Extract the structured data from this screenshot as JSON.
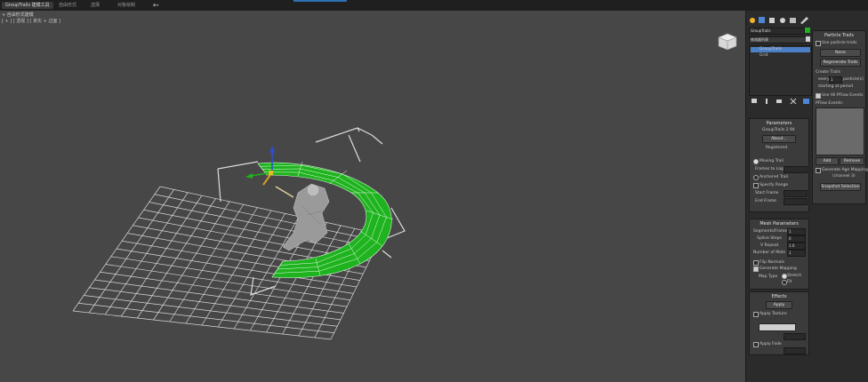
{
  "topbar": {
    "tabs": [
      {
        "label": "GroupTrails 建模工具",
        "active": true
      },
      {
        "label": "自由形式",
        "active": false
      },
      {
        "label": "选择",
        "active": false
      },
      {
        "label": "对象绘制",
        "active": false
      }
    ]
  },
  "viewport": {
    "label": "+ 自由形式建模",
    "menu": "[ + ] [ 透视 ] [ 真实 + 边面 ]"
  },
  "modifier_stack": {
    "name_field": "GroupTrails",
    "modifier_list": "修改器列表",
    "items": [
      {
        "label": "GroupTrails",
        "selected": true
      },
      {
        "label": "Grid",
        "selected": false
      }
    ]
  },
  "parameters": {
    "title": "Parameters",
    "version": "GroupTrails 2.94",
    "about_button": "About...",
    "status": "Registered",
    "moving_trail": "Moving Trail",
    "frames_to_lag": "Frames to Lag",
    "anchored_trail": "Anchored Trail",
    "specify_range": "Specify Range",
    "start_frame": "Start Frame",
    "end_frame": "End Frame"
  },
  "mesh_parameters": {
    "title": "Mesh Parameters",
    "segments_per_frame": "Segments/Frame",
    "segments_per_frame_value": "1",
    "spline_steps": "Spline Steps",
    "spline_steps_value": "0",
    "v_repeat": "V Repeat",
    "v_repeat_value": "1.0",
    "number_of_mats": "Number of Mats",
    "number_of_mats_value": "1",
    "flip_normals": "Flip Normals",
    "generate_mapping": "Generate Mapping",
    "map_type": "Map Type",
    "map_type_stretch": "Stretch",
    "map_type_fit": "Fit"
  },
  "effects": {
    "title": "Effects",
    "apply_button": "Apply",
    "apply_texture": "Apply Texture",
    "apply_fade": "Apply Fade"
  },
  "particle_trails": {
    "title": "Particle Trails",
    "use_particle_trails": "Use particle trails",
    "none_button": "None",
    "regenerate_button": "Regenerate Trails",
    "create_trails": "Create Trails",
    "every_label": "every",
    "every_value": "1",
    "particle_label": "particle(s)",
    "starting_at": "starting at period",
    "use_all_pflow": "Use All PFlow Events",
    "pflow_events": "PFlow Events:",
    "add_button": "Add",
    "remove_button": "Remove",
    "gen_age_mapping": "Generate Age Mapping",
    "channel": "(channel 3)",
    "snapshot_button": "Snapshot Selection"
  },
  "colors": {
    "trail_green": "#1fb31f",
    "accent_blue": "#2d6fb3",
    "selected_item": "#4b7fc6"
  }
}
